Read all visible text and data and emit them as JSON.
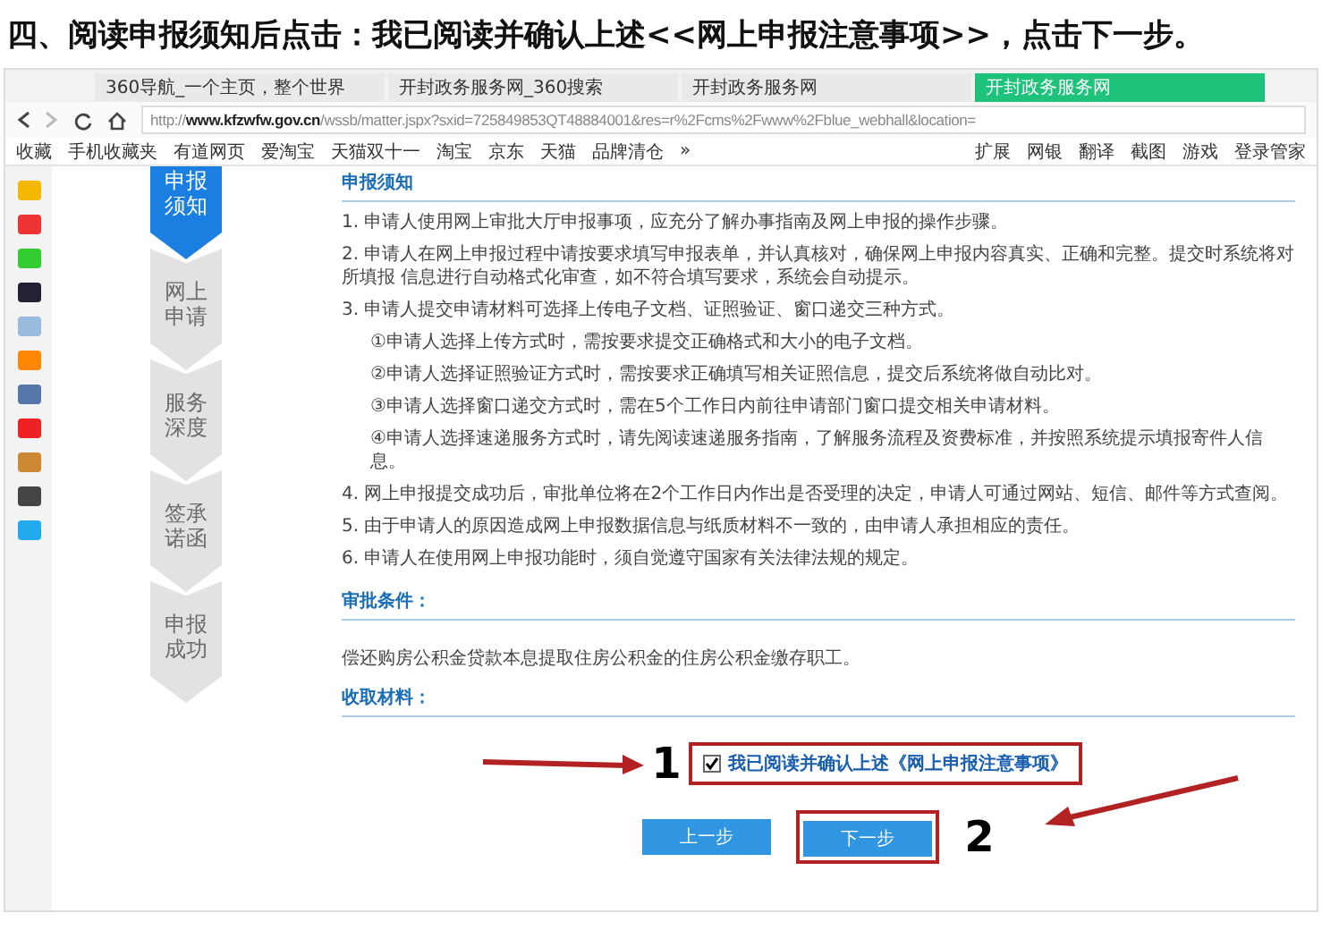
{
  "heading": "四、阅读申报须知后点击：我已阅读并确认上述<<网上申报注意事项>>，点击下一步。",
  "tabs": [
    {
      "title": "360导航_一个主页，整个世界",
      "selected": false
    },
    {
      "title": "开封政务服务网_360搜索",
      "selected": false
    },
    {
      "title": "开封政务服务网",
      "selected": false
    },
    {
      "title": "开封政务服务网",
      "selected": true
    }
  ],
  "address": "http://**www.kfzwfw.gov.cn**/wssb/matter.jspx?sxid=725849853QT48884001&res=r%2Fcms%2Fwww%2Fblue_webhall&location=",
  "bookmarks": [
    "收藏",
    "手机收藏夹",
    "有道网页",
    "爱淘宝",
    "天猫双十一",
    "淘宝",
    "京东",
    "天猫",
    "品牌清仓",
    "»"
  ],
  "tools": [
    "扩展",
    "网银",
    "翻译",
    "截图",
    "游戏",
    "登录管家"
  ],
  "steps": [
    {
      "label": "申报须知",
      "selected": true
    },
    {
      "label": "网上申请",
      "selected": false
    },
    {
      "label": "服务深度",
      "selected": false
    },
    {
      "label": "签承诺函",
      "selected": false
    },
    {
      "label": "申报成功",
      "selected": false
    }
  ],
  "notice_title": "申报须知",
  "notices": [
    {
      "text": "1. 申请人使用网上审批大厅申报事项，应充分了解办事指南及网上申报的操作步骤。",
      "kind": "item"
    },
    {
      "text": "2. 申请人在网上申报过程中请按要求填写申报表单，并认真核对，确保网上申报内容真实、正确和完整。提交时系统将对所填报 信息进行自动格式化审查，如不符合填写要求，系统会自动提示。",
      "kind": "item"
    },
    {
      "text": "3. 申请人提交申请材料可选择上传电子文档、证照验证、窗口递交三种方式。",
      "kind": "item"
    },
    {
      "text": "①申请人选择上传方式时，需按要求提交正确格式和大小的电子文档。",
      "kind": "sub"
    },
    {
      "text": "②申请人选择证照验证方式时，需按要求正确填写相关证照信息，提交后系统将做自动比对。",
      "kind": "sub"
    },
    {
      "text": "③申请人选择窗口递交方式时，需在5个工作日内前往申请部门窗口提交相关申请材料。",
      "kind": "sub"
    },
    {
      "text": "④申请人选择速递服务方式时，请先阅读速递服务指南，了解服务流程及资费标准，并按照系统提示填报寄件人信息。",
      "kind": "sub"
    },
    {
      "text": "4. 网上申报提交成功后，审批单位将在2个工作日内作出是否受理的决定，申请人可通过网站、短信、邮件等方式查阅。",
      "kind": "item"
    },
    {
      "text": "5. 由于申请人的原因造成网上申报数据信息与纸质材料不一致的，由申请人承担相应的责任。",
      "kind": "item"
    },
    {
      "text": "6. 申请人在使用网上申报功能时，须自觉遵守国家有关法律法规的规定。",
      "kind": "item"
    }
  ],
  "conditions": {
    "title": "审批条件：",
    "text": "偿还购房公积金贷款本息提取住房公积金的住房公积金缴存职工。"
  },
  "materials": {
    "title": "收取材料："
  },
  "agree": {
    "label": "我已阅读并确认上述《网上申报注意事项》",
    "checked": true
  },
  "buttons": {
    "prev": "上一步",
    "next": "下一步"
  },
  "callouts": [
    "1",
    "2"
  ]
}
